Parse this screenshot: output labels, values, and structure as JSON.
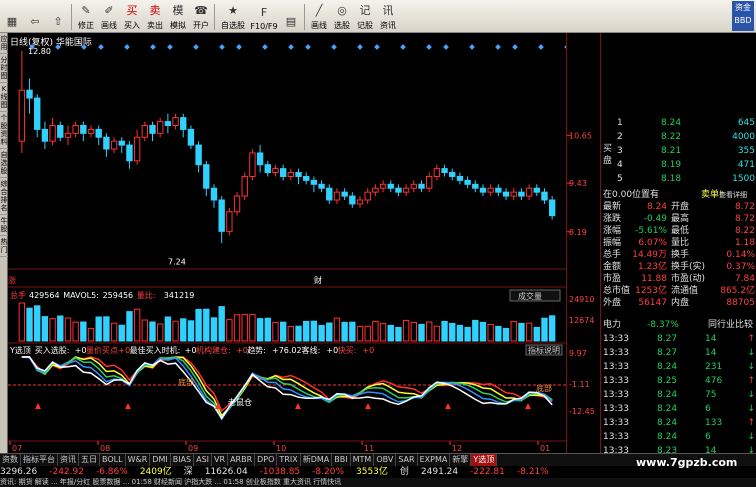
{
  "toolbar": {
    "buttons": [
      {
        "name": "menu",
        "label": "",
        "icon": "grid-icon"
      },
      {
        "name": "back",
        "label": "",
        "icon": "back-arrow-icon"
      },
      {
        "name": "up",
        "label": "",
        "icon": "up-arrow-icon"
      },
      {
        "name": "modify",
        "label": "修正",
        "icon": "edit-icon"
      },
      {
        "name": "chart",
        "label": "画线",
        "icon": "pen-icon"
      },
      {
        "name": "buy",
        "label": "买入",
        "icon": "buy-icon"
      },
      {
        "name": "sell",
        "label": "卖出",
        "icon": "sell-icon"
      },
      {
        "name": "sim",
        "label": "模拟",
        "icon": "sim-icon"
      },
      {
        "name": "open",
        "label": "开户",
        "icon": "open-icon"
      },
      {
        "name": "watch",
        "label": "自选股",
        "icon": "star-icon"
      },
      {
        "name": "f10",
        "label": "F10/F9",
        "icon": "doc-icon"
      },
      {
        "name": "hist",
        "label": "",
        "icon": "hist-icon"
      },
      {
        "name": "line",
        "label": "画线",
        "icon": "draw-icon"
      },
      {
        "name": "pick",
        "label": "选股",
        "icon": "pick-icon"
      },
      {
        "name": "remember",
        "label": "记股",
        "icon": "note-icon"
      },
      {
        "name": "news",
        "label": "资讯",
        "icon": "news-icon"
      }
    ],
    "logo": "资金",
    "logo2": "BBD"
  },
  "left_tabs": [
    "应用",
    "分时图",
    "K线图",
    "个股资料",
    "自选股",
    "综合排名",
    "牛股",
    "热门"
  ],
  "chart": {
    "title": "日线(复权) 华能国际",
    "high_label": "12.80",
    "low_label": "7.24",
    "axis_main": [
      "10.65",
      "9.43",
      "8.19"
    ],
    "vol_header": {
      "v1_label": "总手",
      "v1": "429564",
      "v2_label": "MAVOL5:",
      "v2": "259456",
      "v3_label": "量比:",
      "v3": "341219"
    },
    "vol_tag": "成交量",
    "vol_axis": [
      "24910",
      "12674"
    ],
    "ind_header": {
      "n": "Y选顶",
      "a": "买入选股:",
      "av": "+0",
      "b": "量价买点",
      "bv": "+0",
      "c": "最佳买入时机:",
      "cv": "+0",
      "d": "机构建仓:",
      "dv": "+0",
      "e": "趋势:",
      "ev": "+76.02",
      "f": "客线:",
      "fv": "+0",
      "g": "快买:",
      "gv": "+0"
    },
    "ind_tag": "指标说明",
    "ind_axis": [
      "9.97",
      "-1.11",
      "-12.45"
    ],
    "annot1": "老鼠仓",
    "annot2": "底部",
    "annot3": "底部",
    "months": [
      "07",
      "08",
      "09",
      "10",
      "11",
      "12",
      "01"
    ],
    "marks": [
      "涨",
      "财"
    ]
  },
  "chart_data": {
    "type": "candlestick",
    "ylim": [
      7.24,
      12.8
    ],
    "candles": [
      [
        10.5,
        11.8,
        10.2,
        12.8
      ],
      [
        11.8,
        11.6,
        11.2,
        12.1
      ],
      [
        11.6,
        10.8,
        10.6,
        11.7
      ],
      [
        10.8,
        10.5,
        10.3,
        11.0
      ],
      [
        10.5,
        10.9,
        10.4,
        11.1
      ],
      [
        10.9,
        10.6,
        10.5,
        11.0
      ],
      [
        10.6,
        10.7,
        10.4,
        10.9
      ],
      [
        10.7,
        10.9,
        10.6,
        11.0
      ],
      [
        10.9,
        10.7,
        10.5,
        11.0
      ],
      [
        10.7,
        10.8,
        10.6,
        10.9
      ],
      [
        10.8,
        10.6,
        10.4,
        10.9
      ],
      [
        10.6,
        10.3,
        10.1,
        10.7
      ],
      [
        10.3,
        10.5,
        10.2,
        10.6
      ],
      [
        10.5,
        10.4,
        10.2,
        10.6
      ],
      [
        10.4,
        10.0,
        9.8,
        10.5
      ],
      [
        10.0,
        10.6,
        9.9,
        10.8
      ],
      [
        10.6,
        10.9,
        10.5,
        11.0
      ],
      [
        10.9,
        10.7,
        10.5,
        11.0
      ],
      [
        10.7,
        11.0,
        10.6,
        11.1
      ],
      [
        11.0,
        10.9,
        10.7,
        11.2
      ],
      [
        10.9,
        11.1,
        10.8,
        11.2
      ],
      [
        11.1,
        10.8,
        10.6,
        11.2
      ],
      [
        10.8,
        10.4,
        10.3,
        10.9
      ],
      [
        10.4,
        9.9,
        9.7,
        10.5
      ],
      [
        9.9,
        9.3,
        9.1,
        10.0
      ],
      [
        9.3,
        9.0,
        8.8,
        9.4
      ],
      [
        9.0,
        8.2,
        7.9,
        9.1
      ],
      [
        8.2,
        8.7,
        8.1,
        8.8
      ],
      [
        8.7,
        9.1,
        8.6,
        9.2
      ],
      [
        9.1,
        9.6,
        9.0,
        9.7
      ],
      [
        9.6,
        10.2,
        9.5,
        10.3
      ],
      [
        10.2,
        9.9,
        9.7,
        10.4
      ],
      [
        9.9,
        9.7,
        9.6,
        10.0
      ],
      [
        9.7,
        9.8,
        9.6,
        9.9
      ],
      [
        9.8,
        9.6,
        9.5,
        9.9
      ],
      [
        9.6,
        9.7,
        9.5,
        9.8
      ],
      [
        9.7,
        9.6,
        9.4,
        9.8
      ],
      [
        9.6,
        9.5,
        9.4,
        9.7
      ],
      [
        9.5,
        9.4,
        9.2,
        9.6
      ],
      [
        9.4,
        9.3,
        9.2,
        9.5
      ],
      [
        9.3,
        9.0,
        8.9,
        9.4
      ],
      [
        9.0,
        9.2,
        8.9,
        9.3
      ],
      [
        9.2,
        9.1,
        9.0,
        9.3
      ],
      [
        9.1,
        8.9,
        8.8,
        9.2
      ],
      [
        8.9,
        9.0,
        8.8,
        9.1
      ],
      [
        9.0,
        9.2,
        8.9,
        9.3
      ],
      [
        9.2,
        9.3,
        9.1,
        9.4
      ],
      [
        9.3,
        9.4,
        9.2,
        9.5
      ],
      [
        9.4,
        9.3,
        9.2,
        9.5
      ],
      [
        9.3,
        9.2,
        9.1,
        9.4
      ],
      [
        9.2,
        9.3,
        9.1,
        9.4
      ],
      [
        9.3,
        9.4,
        9.2,
        9.5
      ],
      [
        9.4,
        9.3,
        9.2,
        9.5
      ],
      [
        9.3,
        9.6,
        9.2,
        9.7
      ],
      [
        9.6,
        9.8,
        9.5,
        9.9
      ],
      [
        9.8,
        9.7,
        9.6,
        9.9
      ],
      [
        9.7,
        9.6,
        9.5,
        9.8
      ],
      [
        9.6,
        9.5,
        9.4,
        9.7
      ],
      [
        9.5,
        9.4,
        9.3,
        9.6
      ],
      [
        9.4,
        9.3,
        9.2,
        9.5
      ],
      [
        9.3,
        9.2,
        9.1,
        9.4
      ],
      [
        9.2,
        9.3,
        9.1,
        9.4
      ],
      [
        9.3,
        9.2,
        9.1,
        9.4
      ],
      [
        9.2,
        9.1,
        9.0,
        9.3
      ],
      [
        9.1,
        9.2,
        9.0,
        9.3
      ],
      [
        9.2,
        9.1,
        9.0,
        9.3
      ],
      [
        9.1,
        9.3,
        9.0,
        9.4
      ],
      [
        9.3,
        9.2,
        9.1,
        9.4
      ],
      [
        9.2,
        9.0,
        8.9,
        9.3
      ],
      [
        9.0,
        8.6,
        8.5,
        9.1
      ]
    ]
  },
  "panel": {
    "bid_label": "买盘",
    "bids": [
      [
        "1",
        "8.24",
        "645"
      ],
      [
        "2",
        "8.22",
        "4000"
      ],
      [
        "3",
        "8.21",
        "355"
      ],
      [
        "4",
        "8.19",
        "471"
      ],
      [
        "5",
        "8.18",
        "1500"
      ]
    ],
    "pos_label": "在0.00位置有",
    "sell_tag": "卖单!",
    "detail_tag": "查看详细",
    "rows": [
      [
        "最新",
        "8.24",
        "开盘",
        "8.72"
      ],
      [
        "涨跌",
        "-0.49",
        "最高",
        "8.72"
      ],
      [
        "涨幅",
        "-5.61%",
        "最低",
        "8.22"
      ],
      [
        "振幅",
        "6.07%",
        "量比",
        "1.18"
      ],
      [
        "总手",
        "14.49万",
        "换手",
        "0.14%"
      ],
      [
        "金额",
        "1.23亿",
        "换手(实)",
        "0.37%"
      ],
      [
        "市盈",
        "11.88",
        "市盈(动)",
        "7.84"
      ],
      [
        "总市值",
        "1253亿",
        "流通值",
        "865.2亿"
      ],
      [
        "外盘",
        "56147",
        "内盘",
        "88705"
      ]
    ],
    "power_label": "电力",
    "power_val": "-8.37%",
    "power_rank": "同行业比较",
    "ticks": [
      [
        "13:33",
        "8.27",
        "14"
      ],
      [
        "13:33",
        "8.27",
        "14"
      ],
      [
        "13:33",
        "8.24",
        "231"
      ],
      [
        "13:33",
        "8.25",
        "476"
      ],
      [
        "13:33",
        "8.24",
        "75"
      ],
      [
        "13:33",
        "8.24",
        "6"
      ],
      [
        "13:33",
        "8.24",
        "133"
      ],
      [
        "13:33",
        "8.24",
        "6"
      ],
      [
        "13:33",
        "8.23",
        "14"
      ]
    ]
  },
  "bottom_tabs": [
    "资数",
    "指标平台",
    "资讯",
    "五日",
    "BOLL",
    "W&R",
    "DMI",
    "BIAS",
    "ASI",
    "VR",
    "ARBR",
    "DPO",
    "TRIX",
    "新DMA",
    "BBI",
    "MTM",
    "OBV",
    "SAR",
    "EXPMA",
    "新擎",
    "Y选顶"
  ],
  "status": [
    [
      "3296.26",
      "wht"
    ],
    [
      "-242.92",
      "red"
    ],
    [
      "-6.86%",
      "red"
    ],
    [
      "2409亿",
      "yel"
    ],
    [
      "深",
      "wht"
    ],
    [
      "11626.04",
      "wht"
    ],
    [
      "-1038.85",
      "red"
    ],
    [
      "-8.20%",
      "red"
    ],
    [
      "3553亿",
      "yel"
    ],
    [
      "创",
      "wht"
    ],
    [
      "2491.24",
      "wht"
    ],
    [
      "-222.81",
      "red"
    ],
    [
      "-8.21%",
      "red"
    ]
  ],
  "ticker": "资讯: 期货 解读 ... 年报/分红 股票数据 ... 01:58 财经新闻 沪指大跌 ... 01:58 创业板指数 重大资讯 行情快讯",
  "watermark": "www.7gpzb.com"
}
